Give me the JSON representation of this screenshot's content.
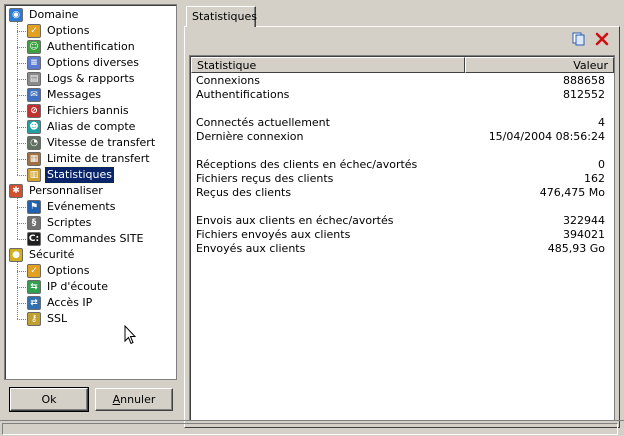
{
  "tree": {
    "items": [
      {
        "label": "Domaine",
        "icon": "globe-icon",
        "level": 0
      },
      {
        "label": "Options",
        "icon": "options-icon",
        "level": 1
      },
      {
        "label": "Authentification",
        "icon": "users-icon",
        "level": 1
      },
      {
        "label": "Options diverses",
        "icon": "document-icon",
        "level": 1
      },
      {
        "label": "Logs & rapports",
        "icon": "log-icon",
        "level": 1
      },
      {
        "label": "Messages",
        "icon": "message-icon",
        "level": 1
      },
      {
        "label": "Fichiers bannis",
        "icon": "banned-file-icon",
        "level": 1
      },
      {
        "label": "Alias de compte",
        "icon": "alias-icon",
        "level": 1
      },
      {
        "label": "Vitesse de transfert",
        "icon": "speedometer-icon",
        "level": 1
      },
      {
        "label": "Limite de transfert",
        "icon": "limit-icon",
        "level": 1
      },
      {
        "label": "Statistiques",
        "icon": "statistics-icon",
        "level": 1,
        "selected": true
      },
      {
        "label": "Personnaliser",
        "icon": "customize-icon",
        "level": 0
      },
      {
        "label": "Evénements",
        "icon": "events-icon",
        "level": 1
      },
      {
        "label": "Scriptes",
        "icon": "script-icon",
        "level": 1
      },
      {
        "label": "Commandes SITE",
        "icon": "console-icon",
        "level": 1
      },
      {
        "label": "Sécurité",
        "icon": "lock-icon",
        "level": 0
      },
      {
        "label": "Options",
        "icon": "options-icon",
        "level": 1
      },
      {
        "label": "IP d'écoute",
        "icon": "network-icon",
        "level": 1
      },
      {
        "label": "Accès IP",
        "icon": "ip-access-icon",
        "level": 1
      },
      {
        "label": "SSL",
        "icon": "key-icon",
        "level": 1
      }
    ]
  },
  "buttons": {
    "ok": "Ok",
    "cancel_first": "A",
    "cancel_rest": "nnuler"
  },
  "tab": {
    "label": "Statistiques"
  },
  "toolbar": {
    "copy_icon": "copy-icon",
    "delete_icon": "delete-icon"
  },
  "table": {
    "headers": {
      "stat": "Statistique",
      "value": "Valeur"
    },
    "rows": [
      {
        "k": "Connexions",
        "v": "888658"
      },
      {
        "k": "Authentifications",
        "v": "812552"
      },
      {
        "k": "",
        "v": ""
      },
      {
        "k": "Connectés actuellement",
        "v": "4"
      },
      {
        "k": "Dernière connexion",
        "v": "15/04/2004 08:56:24"
      },
      {
        "k": "",
        "v": ""
      },
      {
        "k": "Réceptions des clients en échec/avortés",
        "v": "0"
      },
      {
        "k": "Fichiers reçus des clients",
        "v": "162"
      },
      {
        "k": "Reçus des clients",
        "v": "476,475 Mo"
      },
      {
        "k": "",
        "v": ""
      },
      {
        "k": "Envois aux clients en échec/avortés",
        "v": "322944"
      },
      {
        "k": "Fichiers envoyés aux clients",
        "v": "394021"
      },
      {
        "k": "Envoyés aux clients",
        "v": "485,93 Go"
      }
    ]
  }
}
